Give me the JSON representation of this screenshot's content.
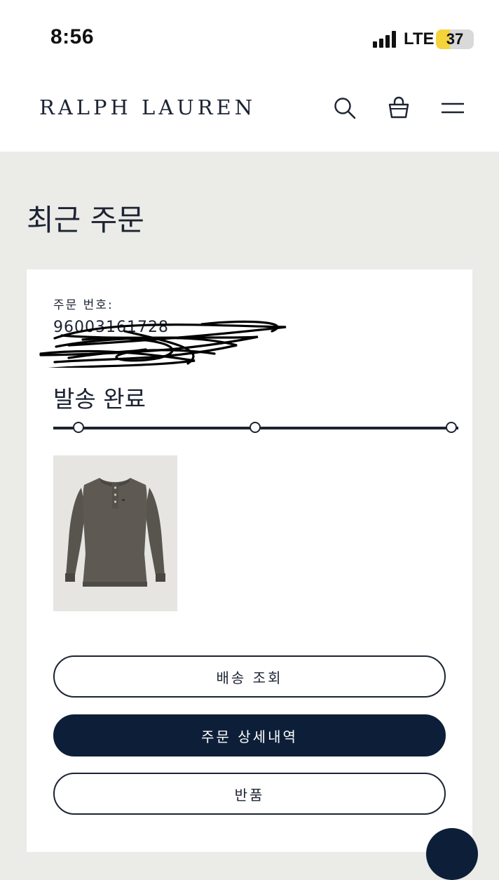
{
  "status_bar": {
    "time": "8:56",
    "network": "LTE",
    "battery": "37",
    "battery_level": 0.37
  },
  "header": {
    "brand": "RALPH LAUREN",
    "icons": [
      "search-icon",
      "shopping-bag-icon",
      "menu-icon"
    ]
  },
  "page": {
    "title": "최근 주문"
  },
  "order": {
    "number_label": "주문 번호:",
    "number": "96003161728",
    "status": "발송 완료",
    "product_image": "long-sleeve-henley-shirt"
  },
  "actions": {
    "track_label": "배송 조회",
    "details_label": "주문 상세내역",
    "return_label": "반품"
  },
  "colors": {
    "navy": "#0d1f38",
    "text": "#1c2333",
    "page_bg": "#ebebe7",
    "battery": "#f5d33a"
  }
}
